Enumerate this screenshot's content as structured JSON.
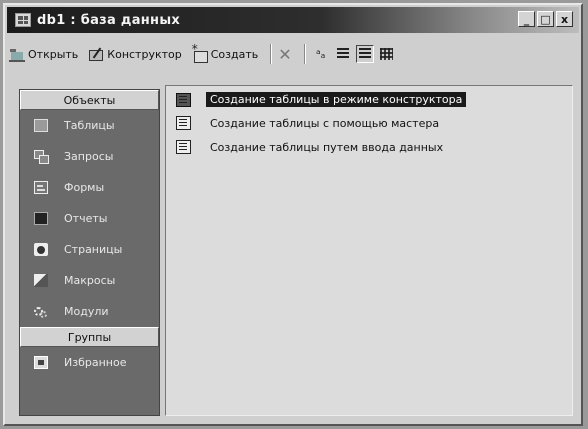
{
  "window": {
    "title": "db1 : база данных"
  },
  "window_buttons": [
    "_",
    "□",
    "x"
  ],
  "toolbar": {
    "open_label": "Открыть",
    "design_label": "Конструктор",
    "new_label": "Создать",
    "delete_symbol": "✕",
    "view_small_symbol": "ᵃₐ"
  },
  "sidebar": {
    "objects_header": "Объекты",
    "items": [
      {
        "label": "Таблицы",
        "icon": "table-icon"
      },
      {
        "label": "Запросы",
        "icon": "query-icon"
      },
      {
        "label": "Формы",
        "icon": "form-icon"
      },
      {
        "label": "Отчеты",
        "icon": "report-icon"
      },
      {
        "label": "Страницы",
        "icon": "page-icon"
      },
      {
        "label": "Макросы",
        "icon": "macro-icon"
      },
      {
        "label": "Модули",
        "icon": "module-icon"
      }
    ],
    "groups_header": "Группы",
    "group_items": [
      {
        "label": "Избранное",
        "icon": "favorites-icon"
      }
    ]
  },
  "main": {
    "items": [
      {
        "label": "Создание таблицы в режиме конструктора",
        "selected": true
      },
      {
        "label": "Создание таблицы с помощью мастера",
        "selected": false
      },
      {
        "label": "Создание таблицы путем ввода данных",
        "selected": false
      }
    ]
  }
}
